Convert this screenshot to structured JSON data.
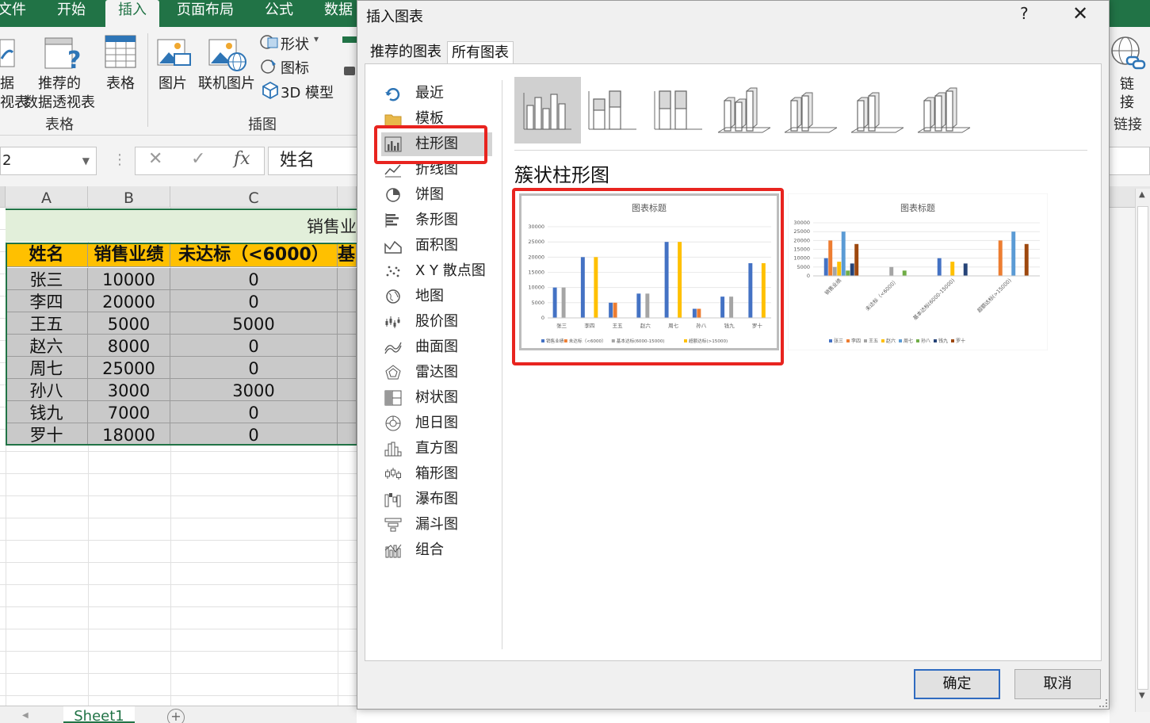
{
  "ribbon": {
    "tabs": [
      "文件",
      "开始",
      "插入",
      "页面布局",
      "公式",
      "数据"
    ],
    "active_tab": "插入",
    "pivot_partial_label_1": "据",
    "pivot_partial_label_2": "视表",
    "recommended_pivot_label_1": "推荐的",
    "recommended_pivot_label_2": "数据透视表",
    "table_label": "表格",
    "group_tables": "表格",
    "picture_label": "图片",
    "online_picture_label": "联机图片",
    "shapes_label": "形状",
    "icons_label": "图标",
    "model3d_label": "3D 模型",
    "group_illustrations": "插图",
    "link_label_1": "链",
    "link_label_2": "接",
    "group_links": "链接"
  },
  "formula_bar": {
    "name_box": "2",
    "cancel_symbol": "✕",
    "enter_symbol": "✓",
    "fx_symbol": "fx",
    "content": "姓名"
  },
  "sheet": {
    "columns": [
      "A",
      "B",
      "C"
    ],
    "title_partial": "销售业",
    "headers": [
      "姓名",
      "销售业绩",
      "未达标（<6000）",
      "基"
    ],
    "rows": [
      [
        "张三",
        "10000",
        "0"
      ],
      [
        "李四",
        "20000",
        "0"
      ],
      [
        "王五",
        "5000",
        "5000"
      ],
      [
        "赵六",
        "8000",
        "0"
      ],
      [
        "周七",
        "25000",
        "0"
      ],
      [
        "孙八",
        "3000",
        "3000"
      ],
      [
        "钱九",
        "7000",
        "0"
      ],
      [
        "罗十",
        "18000",
        "0"
      ]
    ],
    "sheet_tab": "Sheet1",
    "add_sheet": "+"
  },
  "dialog": {
    "title": "插入图表",
    "help": "?",
    "close": "✕",
    "tabs": [
      "推荐的图表",
      "所有图表"
    ],
    "selected_tab": "所有图表",
    "nav": [
      {
        "label": "最近",
        "icon": "recent-icon"
      },
      {
        "label": "模板",
        "icon": "folder-icon"
      },
      {
        "label": "柱形图",
        "icon": "column-chart-icon"
      },
      {
        "label": "折线图",
        "icon": "line-chart-icon"
      },
      {
        "label": "饼图",
        "icon": "pie-chart-icon"
      },
      {
        "label": "条形图",
        "icon": "bar-chart-icon"
      },
      {
        "label": "面积图",
        "icon": "area-chart-icon"
      },
      {
        "label": "X Y 散点图",
        "icon": "scatter-chart-icon"
      },
      {
        "label": "地图",
        "icon": "map-chart-icon"
      },
      {
        "label": "股价图",
        "icon": "stock-chart-icon"
      },
      {
        "label": "曲面图",
        "icon": "surface-chart-icon"
      },
      {
        "label": "雷达图",
        "icon": "radar-chart-icon"
      },
      {
        "label": "树状图",
        "icon": "treemap-chart-icon"
      },
      {
        "label": "旭日图",
        "icon": "sunburst-chart-icon"
      },
      {
        "label": "直方图",
        "icon": "histogram-chart-icon"
      },
      {
        "label": "箱形图",
        "icon": "box-whisker-chart-icon"
      },
      {
        "label": "瀑布图",
        "icon": "waterfall-chart-icon"
      },
      {
        "label": "漏斗图",
        "icon": "funnel-chart-icon"
      },
      {
        "label": "组合",
        "icon": "combo-chart-icon"
      }
    ],
    "selected_nav": "柱形图",
    "subtypes": [
      "簇状柱形图",
      "堆积柱形图",
      "百分比堆积柱形图",
      "三维簇状柱形图",
      "三维堆积柱形图",
      "三维百分比堆积柱形图",
      "三维柱形图"
    ],
    "selected_subtype_title": "簇状柱形图",
    "ok": "确定",
    "cancel": "取消"
  },
  "colors": {
    "excel_green": "#217346",
    "highlight_red": "#e8241f",
    "header_fill": "#ffc000",
    "series_blue": "#4472c4",
    "series_orange": "#ed7d31",
    "series_gray": "#a5a5a5",
    "series_yellow": "#ffc000",
    "series_lightblue": "#5b9bd5",
    "series_green": "#70ad47",
    "series_navy": "#264478",
    "series_brown": "#9e480e"
  },
  "chart_data": [
    {
      "type": "bar",
      "title": "图表标题",
      "categories": [
        "张三",
        "李四",
        "王五",
        "赵六",
        "周七",
        "孙八",
        "钱九",
        "罗十"
      ],
      "series": [
        {
          "name": "销售业绩",
          "values": [
            10000,
            20000,
            5000,
            8000,
            25000,
            3000,
            7000,
            18000
          ]
        },
        {
          "name": "未达标（<6000）",
          "values": [
            0,
            0,
            5000,
            0,
            0,
            3000,
            0,
            0
          ]
        },
        {
          "name": "基本达标(6000-15000)",
          "values": [
            10000,
            0,
            0,
            8000,
            0,
            0,
            7000,
            0
          ]
        },
        {
          "name": "超额达标(>15000)",
          "values": [
            0,
            20000,
            0,
            0,
            25000,
            0,
            0,
            18000
          ]
        }
      ],
      "yticks": [
        "0",
        "5000",
        "10000",
        "15000",
        "20000",
        "25000",
        "30000"
      ],
      "ylim": [
        0,
        30000
      ],
      "legend": "bottom"
    },
    {
      "type": "bar",
      "title": "图表标题",
      "categories": [
        "销售业绩",
        "未达标（<6000）",
        "基本达标(6000-15000)",
        "超额达标(>15000)"
      ],
      "series": [
        {
          "name": "张三",
          "values": [
            10000,
            0,
            10000,
            0
          ]
        },
        {
          "name": "李四",
          "values": [
            20000,
            0,
            0,
            20000
          ]
        },
        {
          "name": "王五",
          "values": [
            5000,
            5000,
            0,
            0
          ]
        },
        {
          "name": "赵六",
          "values": [
            8000,
            0,
            8000,
            0
          ]
        },
        {
          "name": "周七",
          "values": [
            25000,
            0,
            0,
            25000
          ]
        },
        {
          "name": "孙八",
          "values": [
            3000,
            3000,
            0,
            0
          ]
        },
        {
          "name": "钱九",
          "values": [
            7000,
            0,
            7000,
            0
          ]
        },
        {
          "name": "罗十",
          "values": [
            18000,
            0,
            0,
            18000
          ]
        }
      ],
      "yticks": [
        "0",
        "5000",
        "10000",
        "15000",
        "20000",
        "25000",
        "30000"
      ],
      "ylim": [
        0,
        30000
      ],
      "legend": "bottom"
    }
  ]
}
